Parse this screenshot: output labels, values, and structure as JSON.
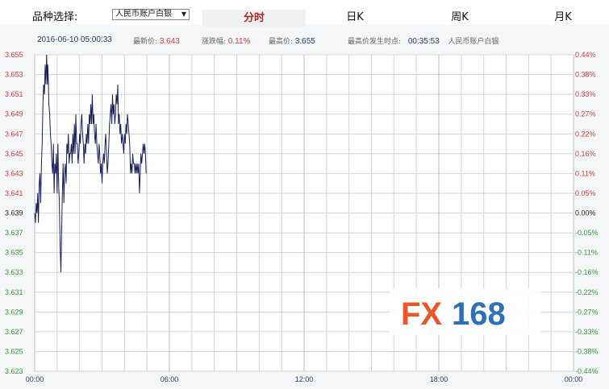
{
  "toolbar": {
    "product_label": "品种选择:",
    "product_selected": "人民币账户白银",
    "tabs": [
      {
        "label": "分时",
        "active": true
      },
      {
        "label": "日K",
        "active": false
      },
      {
        "label": "周K",
        "active": false
      },
      {
        "label": "月K",
        "active": false
      }
    ]
  },
  "info": {
    "datetime": "2016-06-10 05:00:33",
    "latest_label": "最新价:",
    "latest_value": "3.643",
    "change_label": "涨跌幅:",
    "change_value": "0.11%",
    "high_label": "最高价:",
    "high_value": "3.655",
    "high_time_label": "最高价发生时点:",
    "high_time_value": "00:35:53",
    "product_name": "人民币账户白银"
  },
  "watermark": {
    "text_fx": "FX",
    "text_num": "168",
    "color_fx": "#e8572a",
    "color_num": "#2f6fb3"
  },
  "colors": {
    "line": "#1a1f5c",
    "grid": "#d2d4d8",
    "up": "#d43c3c",
    "down": "#3a9a3a",
    "neutral": "#222222",
    "time_label": "#2a3a66"
  },
  "chart_data": {
    "type": "line",
    "title": "",
    "xlabel": "",
    "ylabel": "",
    "prev_close": 3.639,
    "ylim": [
      3.623,
      3.655
    ],
    "xlim_minutes": [
      0,
      1440
    ],
    "x_tick_labels": [
      "00:00",
      "06:00",
      "12:00",
      "18:00",
      "00:00"
    ],
    "x_tick_minutes": [
      0,
      360,
      720,
      1080,
      1440
    ],
    "y_ticks_left": [
      "3.655",
      "3.653",
      "3.651",
      "3.649",
      "3.647",
      "3.645",
      "3.643",
      "3.641",
      "3.639",
      "3.637",
      "3.635",
      "3.633",
      "3.631",
      "3.629",
      "3.627",
      "3.625",
      "3.623"
    ],
    "y_ticks_right": [
      "0.44%",
      "0.38%",
      "0.33%",
      "0.27%",
      "0.22%",
      "0.16%",
      "0.11%",
      "0.05%",
      "0.00%",
      "-0.05%",
      "-0.11%",
      "-0.16%",
      "-0.22%",
      "-0.27%",
      "-0.33%",
      "-0.38%",
      "-0.44%"
    ],
    "grid": true,
    "series": [
      {
        "x": [
          0,
          2,
          4,
          6,
          8,
          10,
          12,
          14,
          16,
          18,
          20,
          22,
          24,
          26,
          28,
          30,
          32,
          34,
          35,
          36,
          38,
          40,
          42,
          44,
          46,
          48,
          50,
          52,
          54,
          56,
          58,
          60,
          62,
          64,
          66,
          68,
          70,
          72,
          74,
          76,
          78,
          80,
          82,
          84,
          86,
          88,
          90,
          92,
          94,
          96,
          98,
          100,
          102,
          104,
          106,
          108,
          110,
          112,
          114,
          116,
          118,
          120,
          122,
          124,
          126,
          128,
          130,
          132,
          134,
          136,
          138,
          140,
          142,
          144,
          146,
          148,
          150,
          152,
          154,
          156,
          158,
          160,
          162,
          164,
          166,
          168,
          170,
          172,
          174,
          176,
          178,
          180,
          182,
          184,
          186,
          188,
          190,
          192,
          194,
          196,
          198,
          200,
          202,
          204,
          206,
          208,
          210,
          212,
          214,
          216,
          218,
          220,
          222,
          224,
          226,
          228,
          230,
          232,
          234,
          236,
          238,
          240,
          242,
          244,
          246,
          248,
          250,
          252,
          254,
          256,
          258,
          260,
          262,
          264,
          266,
          268,
          270,
          272,
          274,
          276,
          278,
          280,
          282,
          284,
          286,
          288,
          290,
          292,
          294,
          296,
          298
        ],
        "values": [
          3.639,
          3.638,
          3.64,
          3.639,
          3.641,
          3.638,
          3.642,
          3.643,
          3.64,
          3.644,
          3.646,
          3.65,
          3.652,
          3.651,
          3.654,
          3.652,
          3.655,
          3.652,
          3.654,
          3.653,
          3.65,
          3.649,
          3.647,
          3.646,
          3.644,
          3.643,
          3.646,
          3.641,
          3.644,
          3.643,
          3.645,
          3.641,
          3.646,
          3.642,
          3.64,
          3.636,
          3.633,
          3.637,
          3.641,
          3.644,
          3.64,
          3.643,
          3.644,
          3.642,
          3.646,
          3.645,
          3.647,
          3.644,
          3.645,
          3.645,
          3.646,
          3.644,
          3.647,
          3.645,
          3.648,
          3.645,
          3.649,
          3.646,
          3.646,
          3.644,
          3.645,
          3.647,
          3.646,
          3.648,
          3.649,
          3.647,
          3.646,
          3.644,
          3.646,
          3.645,
          3.647,
          3.646,
          3.648,
          3.646,
          3.649,
          3.648,
          3.65,
          3.648,
          3.651,
          3.648,
          3.649,
          3.647,
          3.646,
          3.648,
          3.646,
          3.645,
          3.644,
          3.646,
          3.645,
          3.643,
          3.644,
          3.642,
          3.644,
          3.645,
          3.644,
          3.646,
          3.647,
          3.645,
          3.643,
          3.644,
          3.646,
          3.648,
          3.649,
          3.65,
          3.648,
          3.651,
          3.649,
          3.65,
          3.648,
          3.649,
          3.651,
          3.65,
          3.652,
          3.648,
          3.649,
          3.647,
          3.648,
          3.646,
          3.647,
          3.646,
          3.645,
          3.647,
          3.646,
          3.648,
          3.647,
          3.649,
          3.648,
          3.647,
          3.646,
          3.643,
          3.644,
          3.643,
          3.645,
          3.644,
          3.644,
          3.643,
          3.644,
          3.643,
          3.644,
          3.643,
          3.644,
          3.641,
          3.643,
          3.645,
          3.644,
          3.645,
          3.646,
          3.645,
          3.646,
          3.645,
          3.643
        ]
      }
    ]
  }
}
